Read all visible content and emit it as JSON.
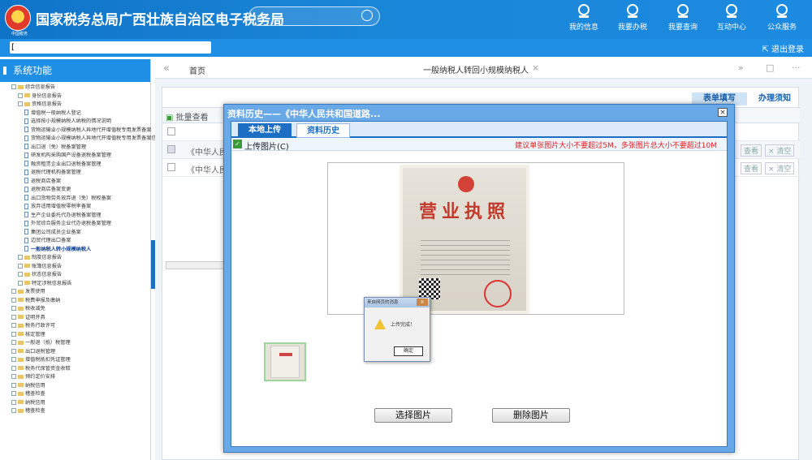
{
  "header": {
    "title": "国家税务总局广西壮族自治区电子税务局",
    "logo_sub": "中国税务",
    "nav": [
      {
        "label": "我的信息",
        "icon": "user-icon"
      },
      {
        "label": "我要办税",
        "icon": "monitor-icon"
      },
      {
        "label": "我要查询",
        "icon": "query-icon"
      },
      {
        "label": "互动中心",
        "icon": "chat-icon"
      },
      {
        "label": "公众服务",
        "icon": "service-icon"
      }
    ]
  },
  "subbar": {
    "user_text": "[",
    "logout": "退出登录"
  },
  "sidebar": {
    "title": "系统功能",
    "tree": [
      {
        "t": "综合信息报告",
        "l": 0,
        "k": "f"
      },
      {
        "t": "身份信息报告",
        "l": 1,
        "k": "f"
      },
      {
        "t": "资格信息报告",
        "l": 1,
        "k": "f"
      },
      {
        "t": "增值税一般纳税人登记",
        "l": 2,
        "k": "d"
      },
      {
        "t": "选择按小规模纳税人纳税的情况说明",
        "l": 2,
        "k": "d"
      },
      {
        "t": "货物运输业小规模纳税人异地代开增值税专用发票备案",
        "l": 2,
        "k": "d"
      },
      {
        "t": "货物运输业小规模纳税人异地代开增值税专用发票备案信息确认",
        "l": 2,
        "k": "d"
      },
      {
        "t": "出口退（免）税备案管理",
        "l": 2,
        "k": "d"
      },
      {
        "t": "研发机构采购国产设备退税备案管理",
        "l": 2,
        "k": "d"
      },
      {
        "t": "融资租赁企业出口退税备案管理",
        "l": 2,
        "k": "d"
      },
      {
        "t": "退税代理机构备案管理",
        "l": 2,
        "k": "d"
      },
      {
        "t": "退税商店备案",
        "l": 2,
        "k": "d"
      },
      {
        "t": "退税商店备案变更",
        "l": 2,
        "k": "d"
      },
      {
        "t": "出口货物劳务放弃退（免）税权备案",
        "l": 2,
        "k": "d"
      },
      {
        "t": "放弃适用增值税零税率备案",
        "l": 2,
        "k": "d"
      },
      {
        "t": "生产企业委托代办退税备案管理",
        "l": 2,
        "k": "d"
      },
      {
        "t": "外贸综合服务企业代办退税备案管理",
        "l": 2,
        "k": "d"
      },
      {
        "t": "集团公司成员企业备案",
        "l": 2,
        "k": "d"
      },
      {
        "t": "边贸代理出口备案",
        "l": 2,
        "k": "d"
      },
      {
        "t": "一般纳税人转小规模纳税人",
        "l": 2,
        "k": "d",
        "sel": true
      },
      {
        "t": "制度信息报告",
        "l": 1,
        "k": "f"
      },
      {
        "t": "账簿信息报告",
        "l": 1,
        "k": "f"
      },
      {
        "t": "状态信息报告",
        "l": 1,
        "k": "f"
      },
      {
        "t": "特定涉税信息报告",
        "l": 1,
        "k": "f"
      },
      {
        "t": "发票使用",
        "l": 0,
        "k": "f"
      },
      {
        "t": "税费申报及缴纳",
        "l": 0,
        "k": "f"
      },
      {
        "t": "税收减免",
        "l": 0,
        "k": "f"
      },
      {
        "t": "证明开具",
        "l": 0,
        "k": "f"
      },
      {
        "t": "税务行政许可",
        "l": 0,
        "k": "f"
      },
      {
        "t": "核定管理",
        "l": 0,
        "k": "f"
      },
      {
        "t": "一般退（抵）税管理",
        "l": 0,
        "k": "f"
      },
      {
        "t": "出口退税管理",
        "l": 0,
        "k": "f"
      },
      {
        "t": "增值税抵扣凭证管理",
        "l": 0,
        "k": "f"
      },
      {
        "t": "税务代保管资金收取",
        "l": 0,
        "k": "f"
      },
      {
        "t": "预约定价安排",
        "l": 0,
        "k": "f"
      },
      {
        "t": "纳税信用",
        "l": 0,
        "k": "f"
      },
      {
        "t": "稽查检查",
        "l": 0,
        "k": "f"
      },
      {
        "t": "纳税信用",
        "l": 0,
        "k": "f"
      },
      {
        "t": "稽查检查",
        "l": 0,
        "k": "f"
      }
    ]
  },
  "tabs": {
    "home": "首页",
    "active": "一般纳税人转回小规模纳税人"
  },
  "main": {
    "fill_btn": "表单填写",
    "guide_btn": "办理须知",
    "batch_label": "批量查看",
    "rows": [
      {
        "name": "《中华人民"
      },
      {
        "name": "《中华人民"
      }
    ],
    "view": "查看",
    "clear": "× 清空"
  },
  "dialog": {
    "title": "资料历史——《中华人民共和国道路...",
    "close": "×",
    "tab_local": "本地上传",
    "tab_history": "资料历史",
    "upload_label": "上传图片(C)",
    "warning": "建议单张图片大小不要超过5M，多张图片总大小不要超过10M",
    "license_title": "营业执照",
    "select_btn": "选择图片",
    "delete_btn": "删除图片"
  },
  "alert": {
    "title": "来自网页的消息",
    "message": "上传完成！",
    "ok": "确定"
  }
}
